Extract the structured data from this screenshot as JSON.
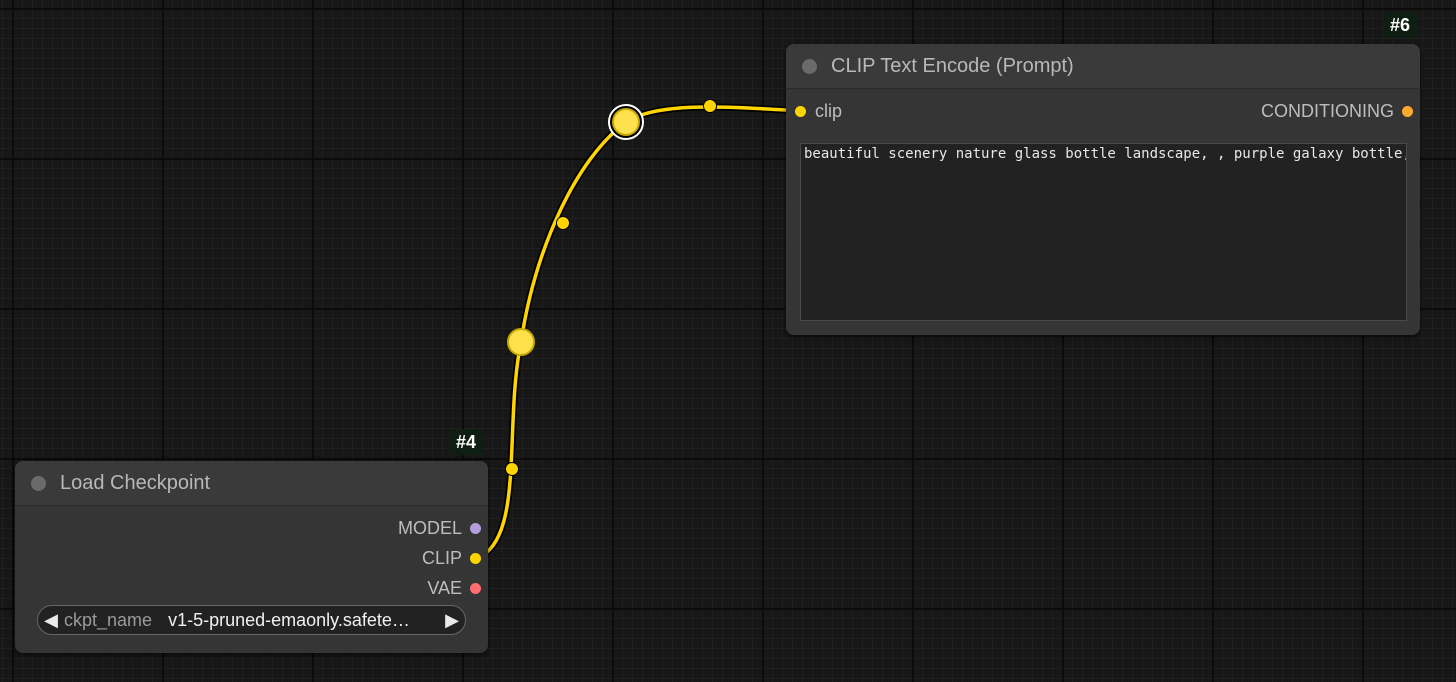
{
  "nodes": {
    "load_checkpoint": {
      "id_badge": "#4",
      "title": "Load Checkpoint",
      "outputs": [
        {
          "label": "MODEL",
          "color": "#b39ddb"
        },
        {
          "label": "CLIP",
          "color": "#ffd500"
        },
        {
          "label": "VAE",
          "color": "#ff6e6e"
        }
      ],
      "widget": {
        "name": "ckpt_name",
        "value": "v1-5-pruned-emaonly.safete…",
        "arrow_left": "◀",
        "arrow_right": "▶"
      }
    },
    "clip_text_encode": {
      "id_badge": "#6",
      "title": "CLIP Text Encode (Prompt)",
      "input": {
        "label": "clip",
        "color": "#ffd500"
      },
      "output": {
        "label": "CONDITIONING",
        "color": "#ffa931"
      },
      "prompt_text": "beautiful scenery nature glass bottle landscape, , purple galaxy bottle,"
    }
  },
  "link": {
    "color": "#ffd500",
    "shadow_color": "#000000"
  }
}
